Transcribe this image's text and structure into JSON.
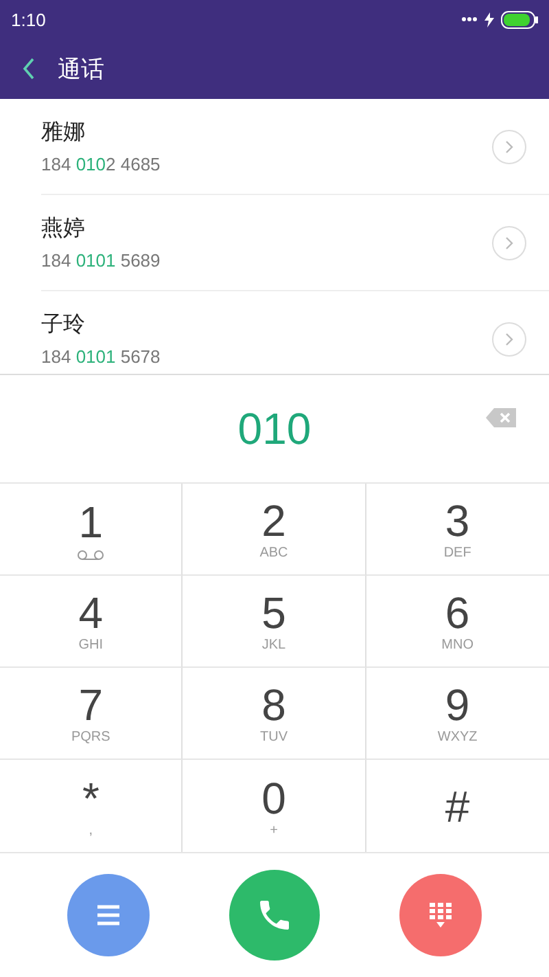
{
  "status_bar": {
    "time": "1:10",
    "charging": true
  },
  "header": {
    "title": "通话"
  },
  "contacts": [
    {
      "name": "雅娜",
      "number_before": "184 ",
      "number_match": "010",
      "number_after": "2 4685"
    },
    {
      "name": "燕婷",
      "number_before": "184 ",
      "number_match": "0101",
      "number_after": " 5689"
    },
    {
      "name": "子玲",
      "number_before": "184 ",
      "number_match": "0101",
      "number_after": " 5678"
    }
  ],
  "dialed_number": "010",
  "keypad": [
    {
      "digit": "1",
      "kind": "voicemail"
    },
    {
      "digit": "2",
      "letters": "ABC",
      "kind": "letters"
    },
    {
      "digit": "3",
      "letters": "DEF",
      "kind": "letters"
    },
    {
      "digit": "4",
      "letters": "GHI",
      "kind": "letters"
    },
    {
      "digit": "5",
      "letters": "JKL",
      "kind": "letters"
    },
    {
      "digit": "6",
      "letters": "MNO",
      "kind": "letters"
    },
    {
      "digit": "7",
      "letters": "PQRS",
      "kind": "letters"
    },
    {
      "digit": "8",
      "letters": "TUV",
      "kind": "letters"
    },
    {
      "digit": "9",
      "letters": "WXYZ",
      "kind": "letters"
    },
    {
      "digit": "*",
      "letters": ",",
      "kind": "letters"
    },
    {
      "digit": "0",
      "letters": "+",
      "kind": "letters"
    },
    {
      "digit": "#",
      "kind": "plain"
    }
  ],
  "actions": [
    {
      "kind": "menu",
      "color": "#6a9aeb"
    },
    {
      "kind": "call",
      "color": "#2dba6a"
    },
    {
      "kind": "keypad",
      "color": "#f56d6d"
    }
  ]
}
